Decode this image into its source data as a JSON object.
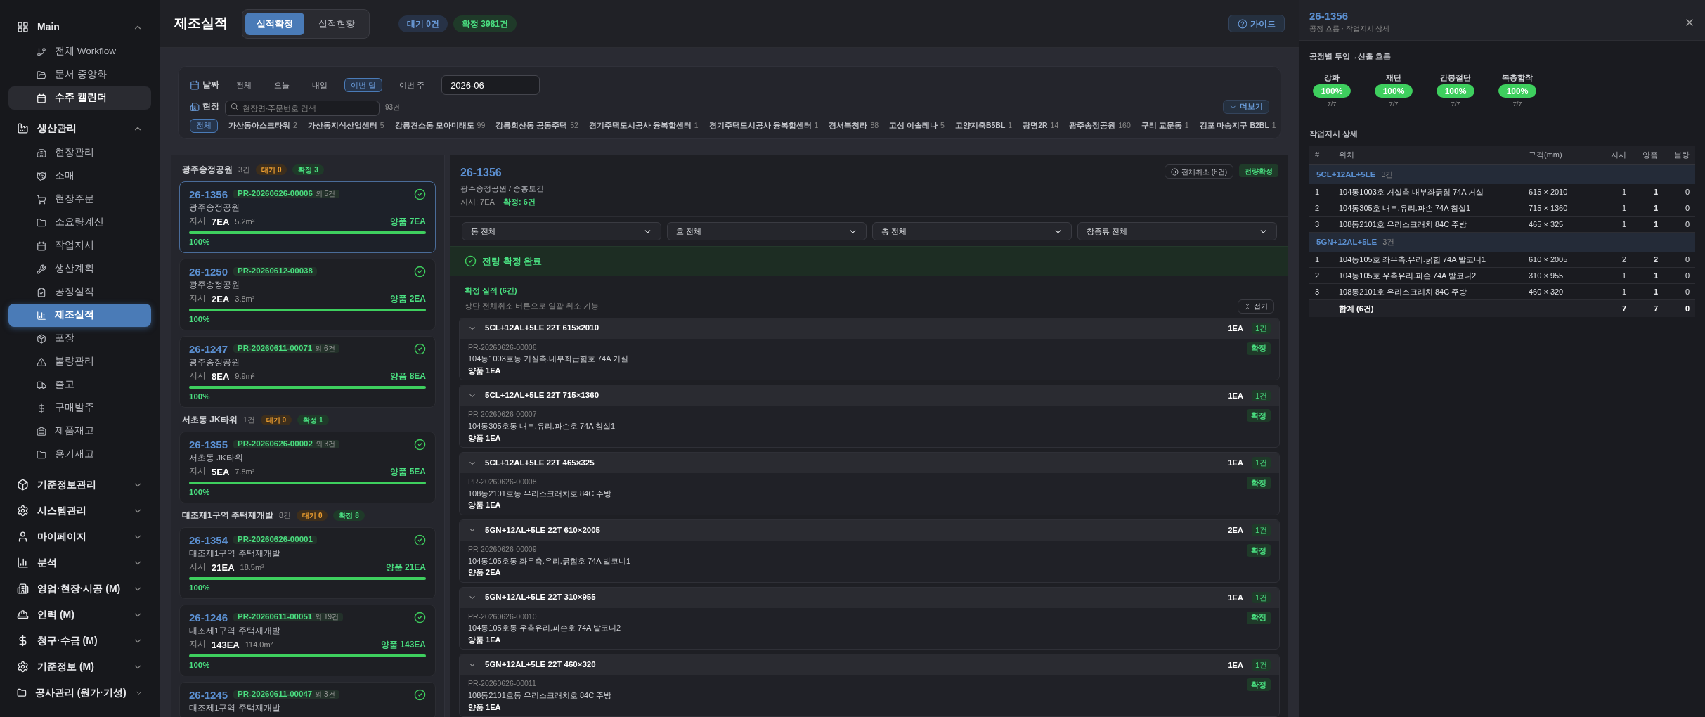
{
  "sidebar": {
    "groups": [
      {
        "label": "Main",
        "expanded": true,
        "items": [
          {
            "label": "전체 Workflow",
            "selected": false,
            "highlighted": false
          },
          {
            "label": "문서 중앙화",
            "selected": false,
            "highlighted": false
          },
          {
            "label": "수주 캘린더",
            "selected": false,
            "highlighted": true
          }
        ]
      },
      {
        "label": "생산관리",
        "expanded": true,
        "items": [
          {
            "label": "현장관리",
            "selected": false,
            "highlighted": false
          },
          {
            "label": "소매",
            "selected": false,
            "highlighted": false
          },
          {
            "label": "현장주문",
            "selected": false,
            "highlighted": false
          },
          {
            "label": "소요량계산",
            "selected": false,
            "highlighted": false
          },
          {
            "label": "작업지시",
            "selected": false,
            "highlighted": false
          },
          {
            "label": "생산계획",
            "selected": false,
            "highlighted": false
          },
          {
            "label": "공정실적",
            "selected": false,
            "highlighted": false
          },
          {
            "label": "제조실적",
            "selected": true,
            "highlighted": false
          },
          {
            "label": "포장",
            "selected": false,
            "highlighted": false
          },
          {
            "label": "불량관리",
            "selected": false,
            "highlighted": false
          },
          {
            "label": "출고",
            "selected": false,
            "highlighted": false
          },
          {
            "label": "구매발주",
            "selected": false,
            "highlighted": false
          },
          {
            "label": "제품재고",
            "selected": false,
            "highlighted": false
          },
          {
            "label": "용기재고",
            "selected": false,
            "highlighted": false
          }
        ]
      },
      {
        "label": "기준정보관리",
        "expanded": false
      },
      {
        "label": "시스템관리",
        "expanded": false
      },
      {
        "label": "마이페이지",
        "expanded": false
      },
      {
        "label": "분석",
        "expanded": false
      },
      {
        "label": "영업·현장·시공 (M)",
        "expanded": false
      },
      {
        "label": "인력 (M)",
        "expanded": false
      },
      {
        "label": "청구·수금 (M)",
        "expanded": false
      },
      {
        "label": "기준정보 (M)",
        "expanded": false
      },
      {
        "label": "공사관리 (원가·기성)",
        "expanded": false
      }
    ]
  },
  "header": {
    "title": "제조실적",
    "tabs": [
      {
        "label": "실적확정",
        "selected": true
      },
      {
        "label": "실적현황",
        "selected": false
      }
    ],
    "badges": [
      {
        "label": "대기 0건",
        "kind": "pending"
      },
      {
        "label": "확정 3981건",
        "kind": "confirmed"
      }
    ],
    "guide_button": "가이드"
  },
  "filter": {
    "date_label": "날짜",
    "date_options": [
      {
        "label": "전체",
        "selected": false
      },
      {
        "label": "오늘",
        "selected": false
      },
      {
        "label": "내일",
        "selected": false
      },
      {
        "label": "이번 달",
        "selected": true
      },
      {
        "label": "이번 주",
        "selected": false
      }
    ],
    "month_value": "2026-06",
    "site_label": "현장",
    "search_placeholder": "현장명·주문번호 검색",
    "site_count": "93건",
    "sites": [
      {
        "name": "전체",
        "selected": true
      },
      {
        "name": "가산동아스크타워",
        "count": "2",
        "selected": false
      },
      {
        "name": "가산동지식산업센터",
        "count": "5",
        "selected": false
      },
      {
        "name": "강릉견소동 모아미래도",
        "count": "99",
        "selected": false
      },
      {
        "name": "강릉회산동 공동주택",
        "count": "52",
        "selected": false
      },
      {
        "name": "경기주택도시공사 융복합센터",
        "count": "1",
        "selected": false
      },
      {
        "name": "경기주택도시공사 융복합센터",
        "count": "1",
        "selected": false
      },
      {
        "name": "경서북청라",
        "count": "88",
        "selected": false
      },
      {
        "name": "고성 이솔레나",
        "count": "5",
        "selected": false
      },
      {
        "name": "고양지축B5BL",
        "count": "1",
        "selected": false
      },
      {
        "name": "광명2R",
        "count": "14",
        "selected": false
      },
      {
        "name": "광주송정공원",
        "count": "160",
        "selected": false
      },
      {
        "name": "구리 교문동",
        "count": "1",
        "selected": false
      },
      {
        "name": "김포 마송지구 B2BL",
        "count": "1",
        "selected": false
      }
    ],
    "more_button": "더보기"
  },
  "order_list": {
    "groups": [
      {
        "site": "광주송정공원",
        "count": "3건",
        "pending": "대기 0",
        "confirmed": "확정 3",
        "cards": [
          {
            "id": "26-1356",
            "order_no": "PR-20260626-00006",
            "extra": "외 5건",
            "site": "광주송정공원",
            "qty_label": "지시",
            "qty": "7EA",
            "area": "5.2m²",
            "good": "양품 7EA",
            "percent": "100%",
            "level": 1,
            "selected": true
          },
          {
            "id": "26-1250",
            "order_no": "PR-20260612-00038",
            "site": "광주송정공원",
            "qty_label": "지시",
            "qty": "2EA",
            "area": "3.8m²",
            "good": "양품 2EA",
            "percent": "100%",
            "level": 1,
            "selected": false
          },
          {
            "id": "26-1247",
            "order_no": "PR-20260611-00071",
            "extra": "외 6건",
            "site": "광주송정공원",
            "qty_label": "지시",
            "qty": "8EA",
            "area": "9.9m²",
            "good": "양품 8EA",
            "percent": "100%",
            "level": 1,
            "selected": false
          }
        ]
      },
      {
        "site": "서초동 JK타워",
        "count": "1건",
        "pending": "대기 0",
        "confirmed": "확정 1",
        "cards": [
          {
            "id": "26-1355",
            "order_no": "PR-20260626-00002",
            "extra": "외 3건",
            "site": "서초동 JK타워",
            "qty_label": "지시",
            "qty": "5EA",
            "area": "7.8m²",
            "good": "양품 5EA",
            "percent": "100%",
            "level": 1,
            "selected": false
          }
        ]
      },
      {
        "site": "대조제1구역 주택재개발",
        "count": "8건",
        "pending": "대기 0",
        "confirmed": "확정 8",
        "cards": [
          {
            "id": "26-1354",
            "order_no": "PR-20260626-00001",
            "site": "대조제1구역 주택재개발",
            "qty_label": "지시",
            "qty": "21EA",
            "area": "18.5m²",
            "good": "양품 21EA",
            "percent": "100%",
            "level": 1,
            "selected": false
          },
          {
            "id": "26-1246",
            "order_no": "PR-20260611-00051",
            "extra": "외 19건",
            "site": "대조제1구역 주택재개발",
            "qty_label": "지시",
            "qty": "143EA",
            "area": "114.0m²",
            "good": "양품 143EA",
            "percent": "100%",
            "level": 1,
            "selected": false
          },
          {
            "id": "26-1245",
            "order_no": "PR-20260611-00047",
            "extra": "외 3건",
            "site": "대조제1구역 주택재개발",
            "selected": false
          }
        ]
      }
    ]
  },
  "detail": {
    "id": "26-1356",
    "subtitle": "광주송정공원 / 중흥토건",
    "ordered": "지시: 7EA",
    "confirmed": "확정: 6건",
    "cancel_button": "전체취소 (6건)",
    "status_badge": "전량확정",
    "filters": [
      "동 전체",
      "호 전체",
      "층 전체",
      "창종류 전체"
    ],
    "banner": "전량 확정 완료",
    "section_title": "확정 실적 (6건)",
    "section_hint": "상단 전체취소 버튼으로 일괄 취소 가능",
    "collapse_button": "접기",
    "items": [
      {
        "spec": "5CL+12AL+5LE 22T 615×2010",
        "qty": "1EA",
        "count": "1건",
        "order_no": "PR-20260626-00006",
        "location": "104동1003호동 거실측.내부좌굽힘호 74A 거실",
        "good": "양품 1EA",
        "status": "확정",
        "expanded": true
      },
      {
        "spec": "5CL+12AL+5LE 22T 715×1360",
        "qty": "1EA",
        "count": "1건",
        "order_no": "PR-20260626-00007",
        "location": "104동305호동 내부.유리.파손호 74A 침실1",
        "good": "양품 1EA",
        "status": "확정",
        "expanded": true
      },
      {
        "spec": "5CL+12AL+5LE 22T 465×325",
        "qty": "1EA",
        "count": "1건",
        "order_no": "PR-20260626-00008",
        "location": "108동2101호동 유리스크래치호 84C 주방",
        "good": "양품 1EA",
        "status": "확정",
        "expanded": true
      },
      {
        "spec": "5GN+12AL+5LE 22T 610×2005",
        "qty": "2EA",
        "count": "1건",
        "order_no": "PR-20260626-00009",
        "location": "104동105호동 좌우측.유리.굵힘호 74A 발코니1",
        "good": "양품 2EA",
        "status": "확정",
        "expanded": true
      },
      {
        "spec": "5GN+12AL+5LE 22T 310×955",
        "qty": "1EA",
        "count": "1건",
        "order_no": "PR-20260626-00010",
        "location": "104동105호동 우측유리.파손호 74A 발코니2",
        "good": "양품 1EA",
        "status": "확정",
        "expanded": true
      },
      {
        "spec": "5GN+12AL+5LE 22T 460×320",
        "qty": "1EA",
        "count": "1건",
        "order_no": "PR-20260626-00011",
        "location": "108동2101호동 유리스크래치호 84C 주방",
        "good": "양품 1EA",
        "status": "확정",
        "expanded": true
      }
    ]
  },
  "drawer": {
    "title": "26-1356",
    "subtitle": "공정 흐름 · 작업지시 상세",
    "flow_title": "공정별 투입→산출 흐름",
    "steps": [
      {
        "name": "강화",
        "percent": "100%",
        "ratio": "7/7"
      },
      {
        "name": "재단",
        "percent": "100%",
        "ratio": "7/7"
      },
      {
        "name": "간봉절단",
        "percent": "100%",
        "ratio": "7/7"
      },
      {
        "name": "복층합착",
        "percent": "100%",
        "ratio": "7/7"
      }
    ],
    "table_title": "작업지시 상세",
    "columns": [
      "#",
      "위치",
      "규격(mm)",
      "지시",
      "양품",
      "불량"
    ],
    "groups": [
      {
        "label": "5CL+12AL+5LE",
        "count": "3건",
        "rows": [
          {
            "no": "1",
            "location": "104동1003호 거실측.내부좌굵힘 74A 거실",
            "size": "615 × 2010",
            "ordered": "1",
            "good": "1",
            "defect": "0"
          },
          {
            "no": "2",
            "location": "104동305호 내부.유리.파손 74A 침실1",
            "size": "715 × 1360",
            "ordered": "1",
            "good": "1",
            "defect": "0"
          },
          {
            "no": "3",
            "location": "108동2101호 유리스크래치 84C 주방",
            "size": "465 × 325",
            "ordered": "1",
            "good": "1",
            "defect": "0"
          }
        ]
      },
      {
        "label": "5GN+12AL+5LE",
        "count": "3건",
        "rows": [
          {
            "no": "1",
            "location": "104동105호 좌우측.유리.굵힘 74A 발코니1",
            "size": "610 × 2005",
            "ordered": "2",
            "good": "2",
            "defect": "0"
          },
          {
            "no": "2",
            "location": "104동105호 우측유리.파손 74A 발코니2",
            "size": "310 × 955",
            "ordered": "1",
            "good": "1",
            "defect": "0"
          },
          {
            "no": "3",
            "location": "108동2101호 유리스크래치 84C 주방",
            "size": "460 × 320",
            "ordered": "1",
            "good": "1",
            "defect": "0"
          }
        ]
      }
    ],
    "total": {
      "label": "합계 (6건)",
      "ordered": "7",
      "good": "7",
      "defect": "0"
    }
  }
}
